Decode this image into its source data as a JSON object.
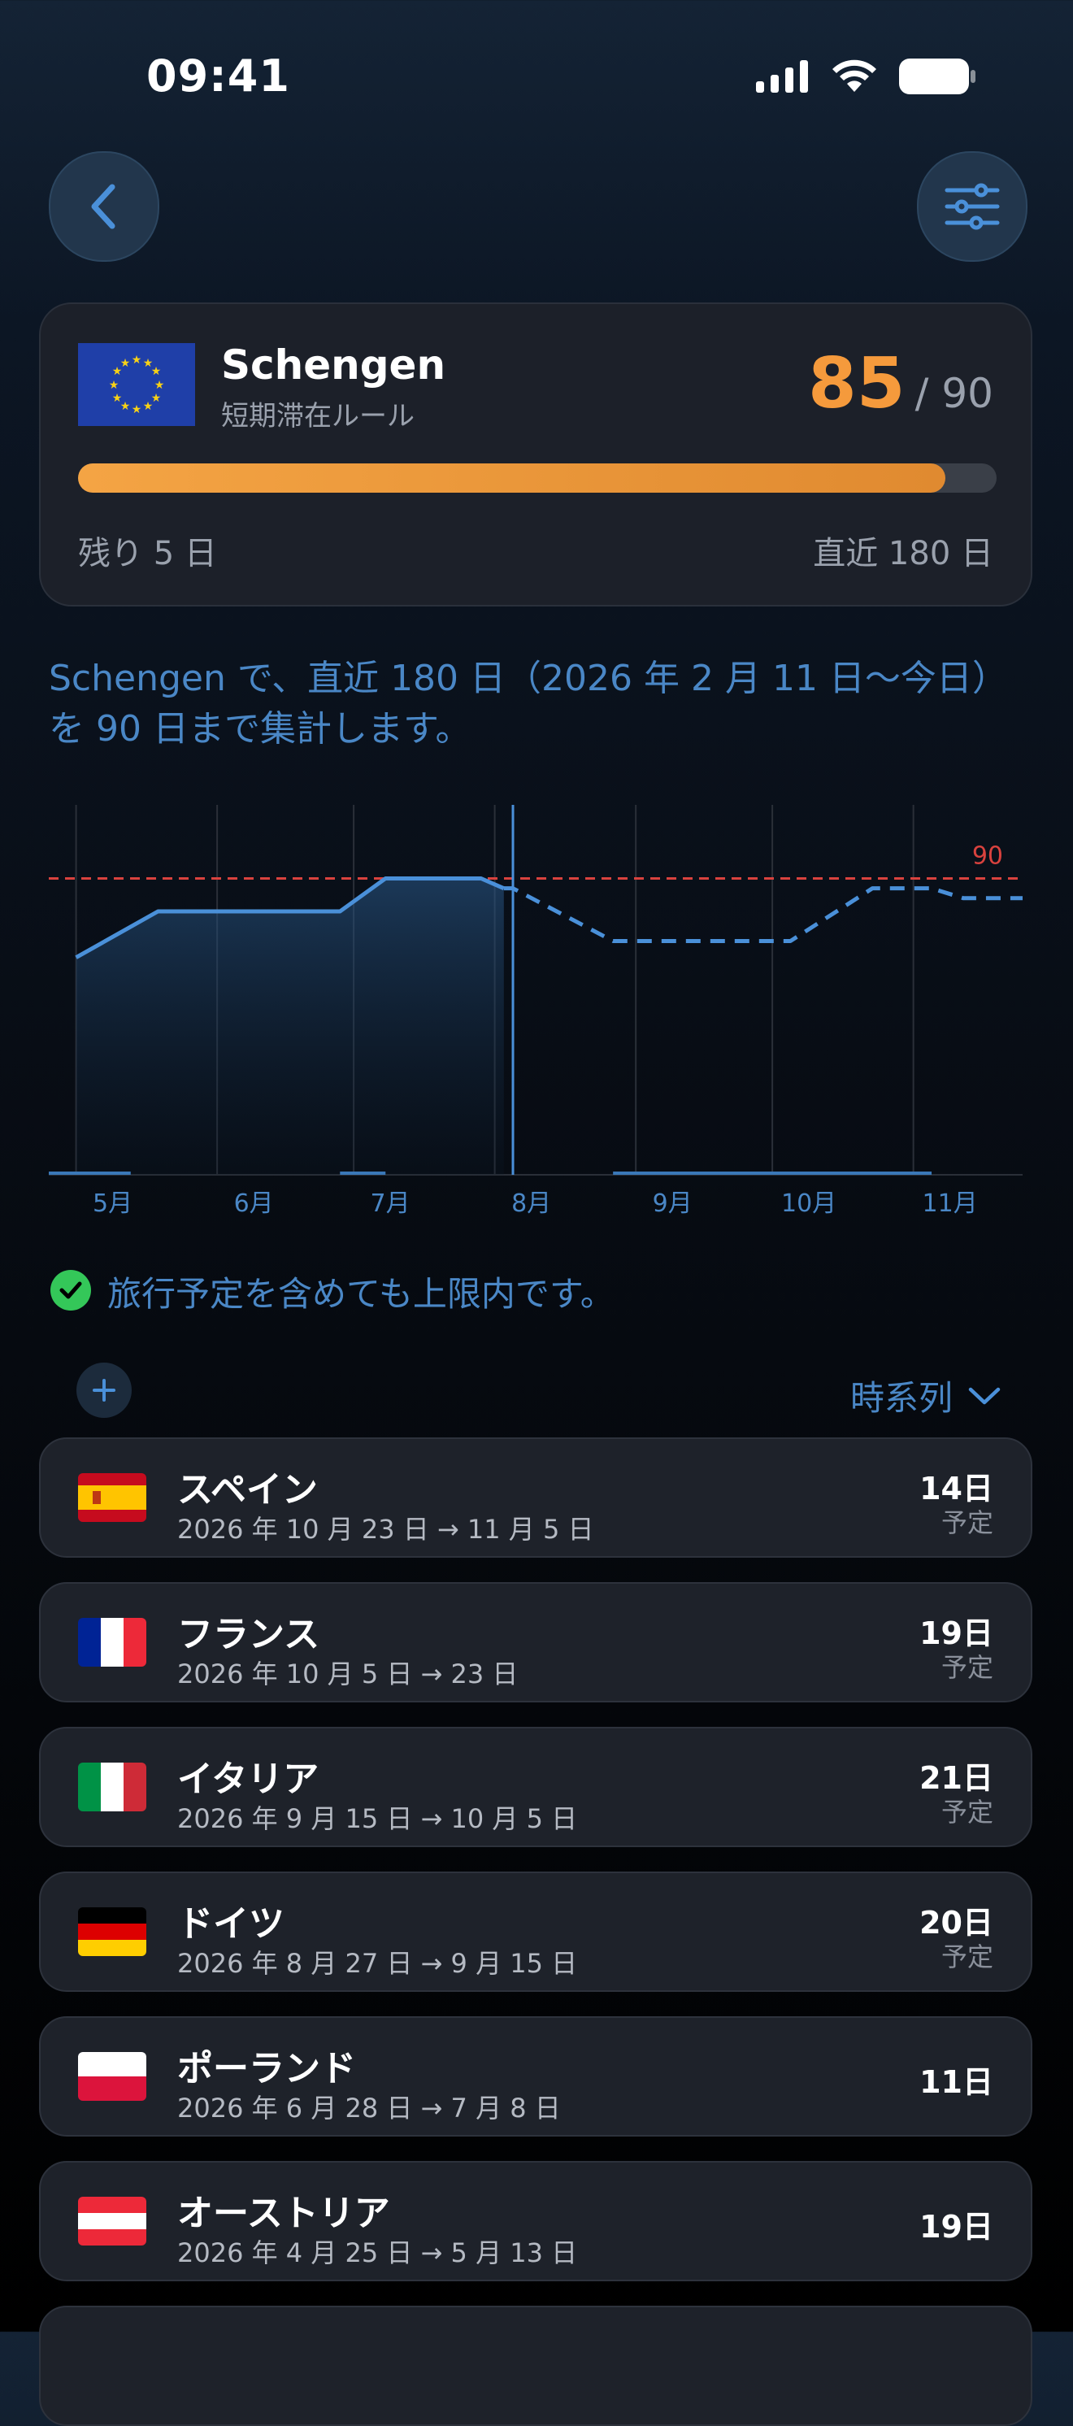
{
  "status_bar": {
    "time": "09:41"
  },
  "icons": {
    "back": "chevron-left-icon",
    "filter": "sliders-icon",
    "check": "checkmark-circle-icon",
    "add": "plus-icon",
    "sort": "chevron-down-icon"
  },
  "summary": {
    "title": "Schengen",
    "subtitle": "短期滞在ルール",
    "used": "85",
    "limit": "/ 90",
    "progress": 0.944,
    "remaining": "残り 5 日",
    "window": "直近 180 日"
  },
  "description": "Schengen で、直近 180 日（2026 年 2 月 11 日〜今日）を 90 日まで集計します。",
  "status_message": "旅行予定を含めても上限内です。",
  "sort_label": "時系列",
  "chart_data": {
    "type": "line",
    "x_labels": [
      "5月",
      "6月",
      "7月",
      "8月",
      "9月",
      "10月",
      "11月"
    ],
    "limit_line": {
      "value": 90,
      "label": "90",
      "color": "#d9423e"
    },
    "ylim": [
      0,
      100
    ],
    "series": [
      {
        "style": "solid",
        "color": "#4a90d9",
        "points": [
          [
            "2026-05-01",
            66
          ],
          [
            "2026-05-19",
            80
          ],
          [
            "2026-06-28",
            80
          ],
          [
            "2026-07-08",
            90
          ],
          [
            "2026-07-29",
            90
          ],
          [
            "2026-08-03",
            87
          ]
        ]
      },
      {
        "style": "dashed",
        "color": "#4a90d9",
        "points": [
          [
            "2026-08-03",
            87
          ],
          [
            "2026-08-05",
            87
          ],
          [
            "2026-08-27",
            71
          ],
          [
            "2026-10-05",
            71
          ],
          [
            "2026-10-23",
            87
          ],
          [
            "2026-11-05",
            87
          ],
          [
            "2026-11-12",
            84
          ],
          [
            "2026-11-25",
            84
          ]
        ]
      }
    ],
    "today": "2026-08-05"
  },
  "trips": [
    {
      "country": "スペイン",
      "dates": "2026 年 10 月 23 日 → 11 月 5 日",
      "days": "14日",
      "status": "予定",
      "flag": "spain"
    },
    {
      "country": "フランス",
      "dates": "2026 年 10 月 5 日 → 23 日",
      "days": "19日",
      "status": "予定",
      "flag": "france"
    },
    {
      "country": "イタリア",
      "dates": "2026 年 9 月 15 日 → 10 月 5 日",
      "days": "21日",
      "status": "予定",
      "flag": "italy"
    },
    {
      "country": "ドイツ",
      "dates": "2026 年 8 月 27 日 → 9 月 15 日",
      "days": "20日",
      "status": "予定",
      "flag": "germany"
    },
    {
      "country": "ポーランド",
      "dates": "2026 年 6 月 28 日 → 7 月 8 日",
      "days": "11日",
      "status": "",
      "flag": "poland"
    },
    {
      "country": "オーストリア",
      "dates": "2026 年 4 月 25 日 → 5 月 13 日",
      "days": "19日",
      "status": "",
      "flag": "austria"
    }
  ],
  "colors": {
    "accent": "#4a87c6",
    "warning": "#f59a3c",
    "success": "#34c759",
    "limit": "#d9423e"
  }
}
